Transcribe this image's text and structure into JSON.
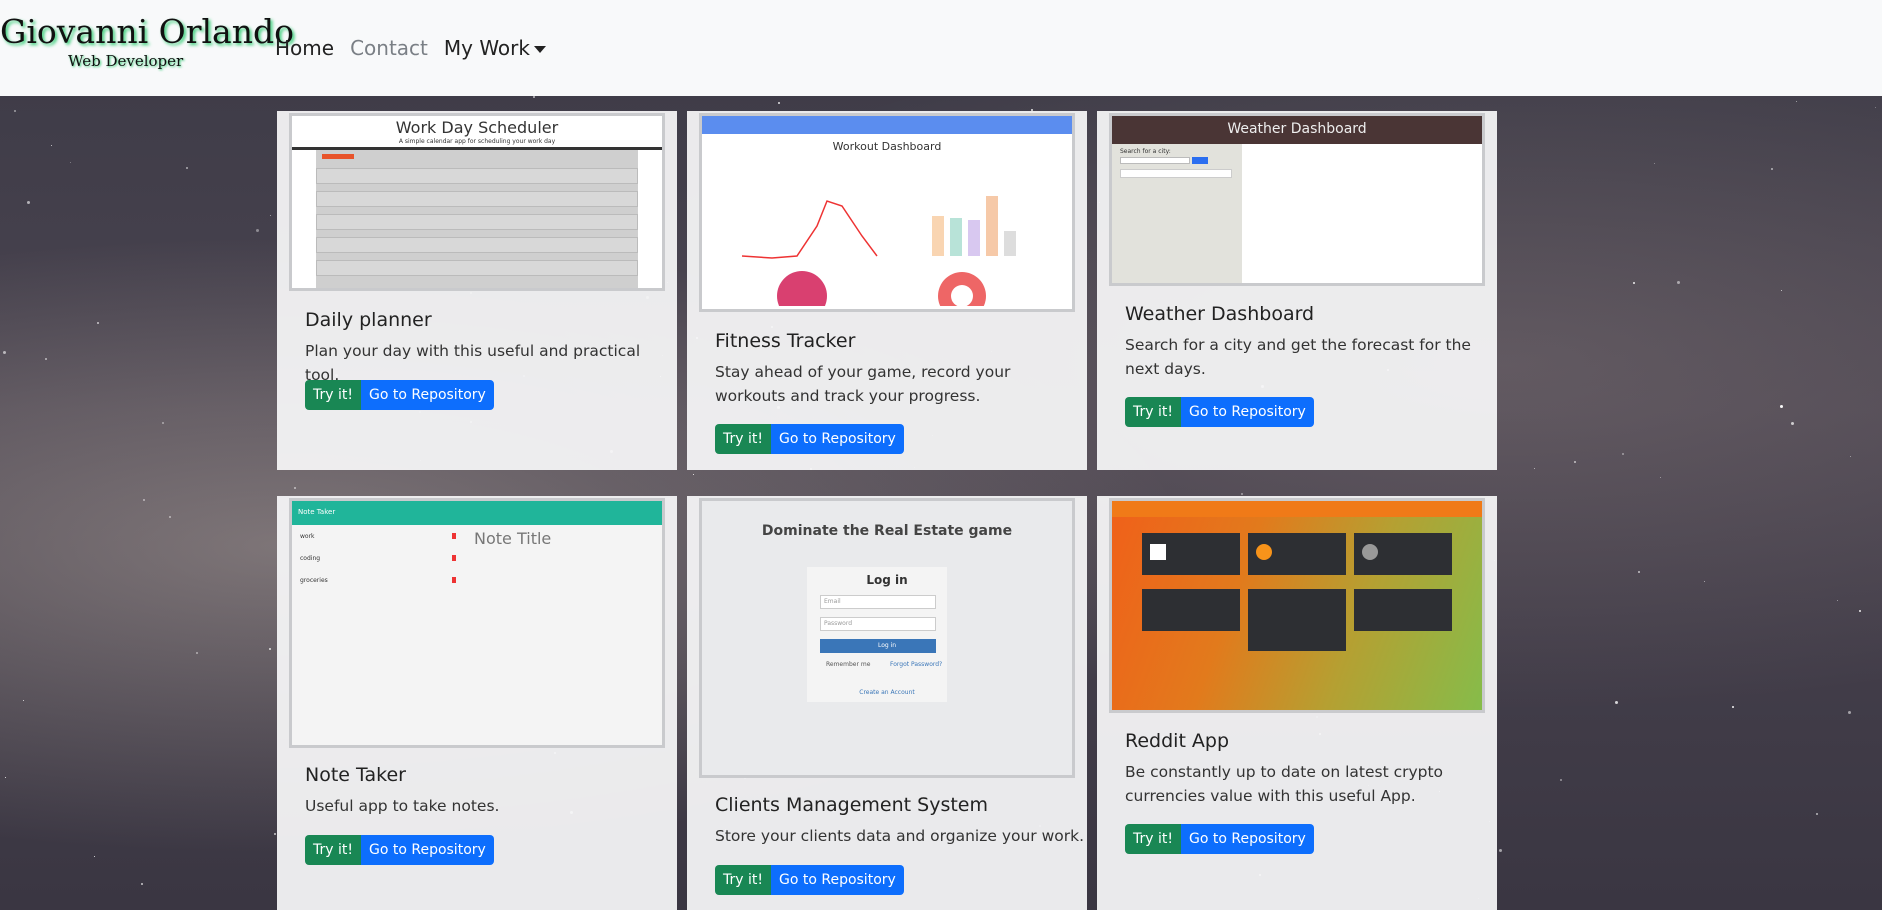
{
  "brand": {
    "name": "Giovanni Orlando",
    "subtitle": "Web Developer"
  },
  "nav": {
    "home": "Home",
    "contact": "Contact",
    "my_work": "My Work"
  },
  "buttons": {
    "try": "Try it!",
    "repo": "Go to Repository"
  },
  "projects": [
    {
      "title": "Daily planner",
      "description": "Plan your day with this useful and practical tool.",
      "thumb_title": "Work Day Scheduler",
      "thumb_sub": "A simple calendar app for scheduling your work day"
    },
    {
      "title": "Fitness Tracker",
      "description": "Stay ahead of your game, record your workouts and track your progress.",
      "thumb_title": "Workout Dashboard"
    },
    {
      "title": "Weather Dashboard",
      "description": "Search for a city and get the forecast for the next days.",
      "thumb_title": "Weather Dashboard",
      "thumb_label": "Search for a city:"
    },
    {
      "title": "Note Taker",
      "description": "Useful app to take notes.",
      "thumb_title": "Note Title",
      "thumb_header": "Note Taker",
      "thumb_items": [
        "work",
        "coding",
        "groceries"
      ]
    },
    {
      "title": "Clients Management System",
      "description": "Store your clients data and organize your work.",
      "thumb_title": "Dominate the Real Estate game",
      "thumb_login": "Log in",
      "thumb_email": "Email",
      "thumb_password": "Password",
      "thumb_button": "Log in",
      "thumb_remember": "Remember me",
      "thumb_forgot": "Forgot Password?",
      "thumb_create": "Create an Account"
    },
    {
      "title": "Reddit App",
      "description": "Be constantly up to date on latest crypto currencies value with this useful App."
    }
  ],
  "colors": {
    "try_button": "#198754",
    "repo_button": "#0d6efd",
    "navbar": "#f8f9fa"
  }
}
